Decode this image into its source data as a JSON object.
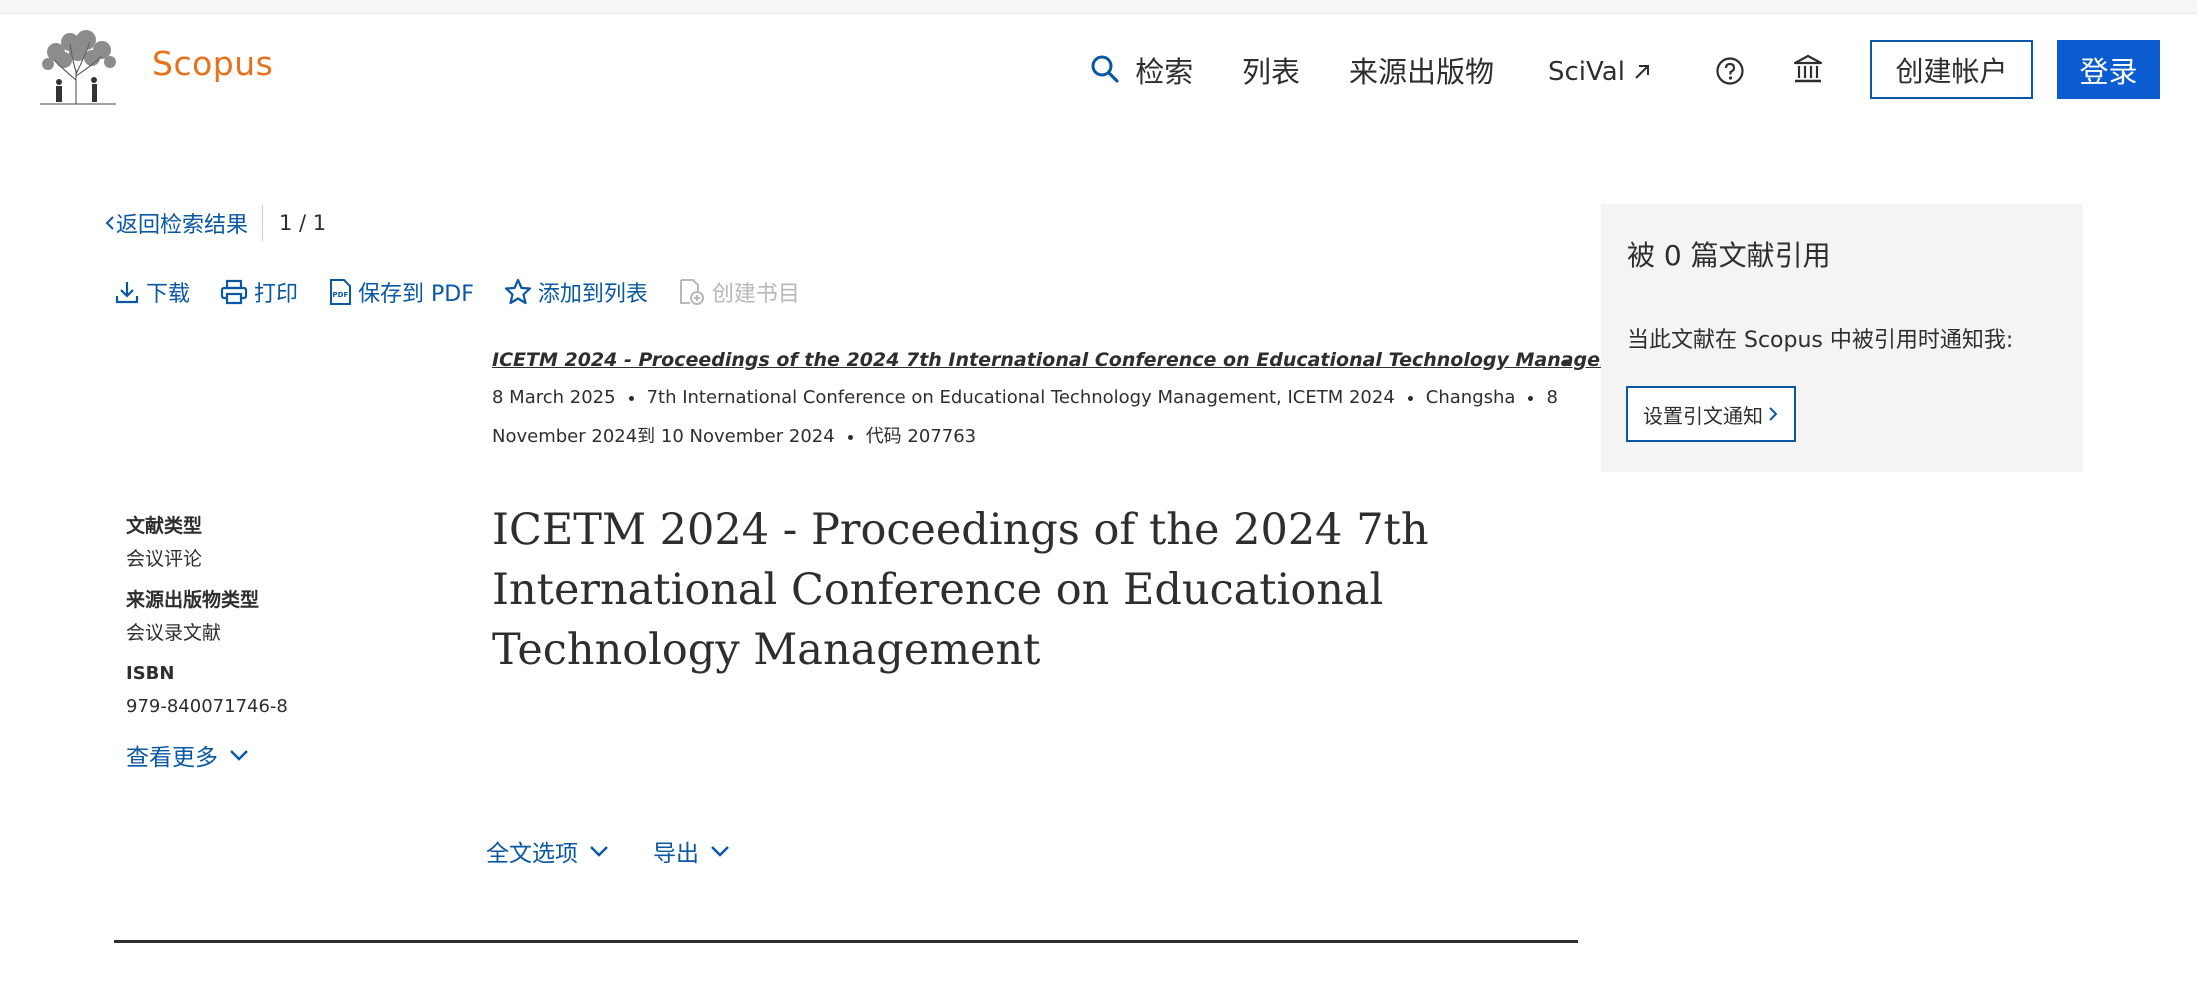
{
  "brand": {
    "name": "Scopus",
    "color": "#e9711c"
  },
  "nav": {
    "search_label": "检索",
    "lists_label": "列表",
    "sources_label": "来源出版物",
    "scival_label": "SciVal",
    "create_account_label": "创建帐户",
    "login_label": "登录"
  },
  "back": {
    "label": "返回检索结果",
    "pager": "1 / 1"
  },
  "toolbar": {
    "download": "下载",
    "print": "打印",
    "save_pdf": "保存到 PDF",
    "add_to_list": "添加到列表",
    "create_bib": "创建书目"
  },
  "document": {
    "source_title": "ICETM 2024 - Proceedings of the 2024 7th International Conference on Educational Technology Management",
    "date": "8 March 2025",
    "conference": "7th International Conference on Educational Technology Management, ICETM 2024",
    "location": "Changsha",
    "period_start": "8",
    "period_rest": "November 2024到 10 November 2024",
    "code": "代码 207763",
    "title": "ICETM 2024 - Proceedings of the 2024 7th International Conference on Educational Technology Management"
  },
  "meta": {
    "doc_type_label": "文献类型",
    "doc_type_value": "会议评论",
    "source_type_label": "来源出版物类型",
    "source_type_value": "会议录文献",
    "isbn_label": "ISBN",
    "isbn_value": "979-840071746-8",
    "see_more": "查看更多"
  },
  "options": {
    "full_text": "全文选项",
    "export": "导出"
  },
  "citations": {
    "title": "被 0 篇文献引用",
    "notify_text": "当此文献在 Scopus 中被引用时通知我:",
    "alert_button": "设置引文通知"
  },
  "colors": {
    "link": "#0a57a4",
    "primary": "#0b5cd0",
    "card_bg": "#f4f4f4"
  }
}
